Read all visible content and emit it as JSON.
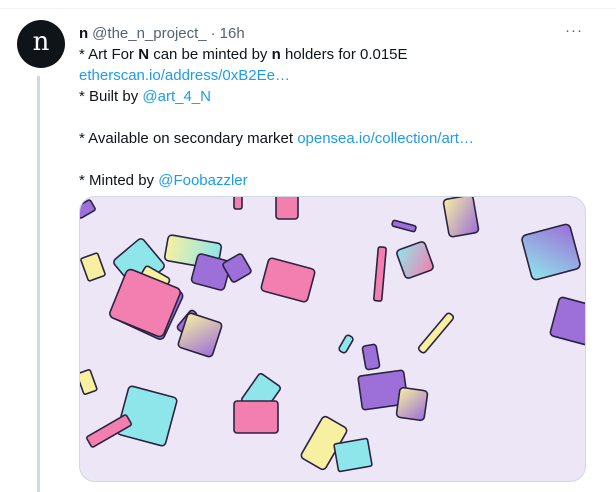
{
  "tweet": {
    "avatar_letter": "n",
    "display_name": "n",
    "handle": "@the_n_project_",
    "separator": "·",
    "time": "16h",
    "more_label": "···",
    "line1": {
      "p1": "* Art For ",
      "b1": "N",
      "p2": " can be minted by ",
      "b2": "n",
      "p3": " holders for 0.015E"
    },
    "etherscan_link": "etherscan.io/address/0xB2Ee…",
    "built_by_prefix": "* Built by ",
    "built_by_link": "@art_4_N",
    "secondary_prefix": "* Available on secondary market ",
    "opensea_link": "opensea.io/collection/art…",
    "minted_by_prefix": "* Minted by ",
    "minted_by_link": "@Foobazzler"
  },
  "colors": {
    "link": "#1d9bf0",
    "text": "#0f1419",
    "muted": "#536471",
    "media_bg": "#ede6f6",
    "tile_pink": "#f27fb0",
    "tile_cyan": "#8fe6ea",
    "tile_purple": "#9c6fd9",
    "tile_yellow": "#f6f0a0"
  },
  "media": {
    "description_icon": "generative-art-image"
  }
}
